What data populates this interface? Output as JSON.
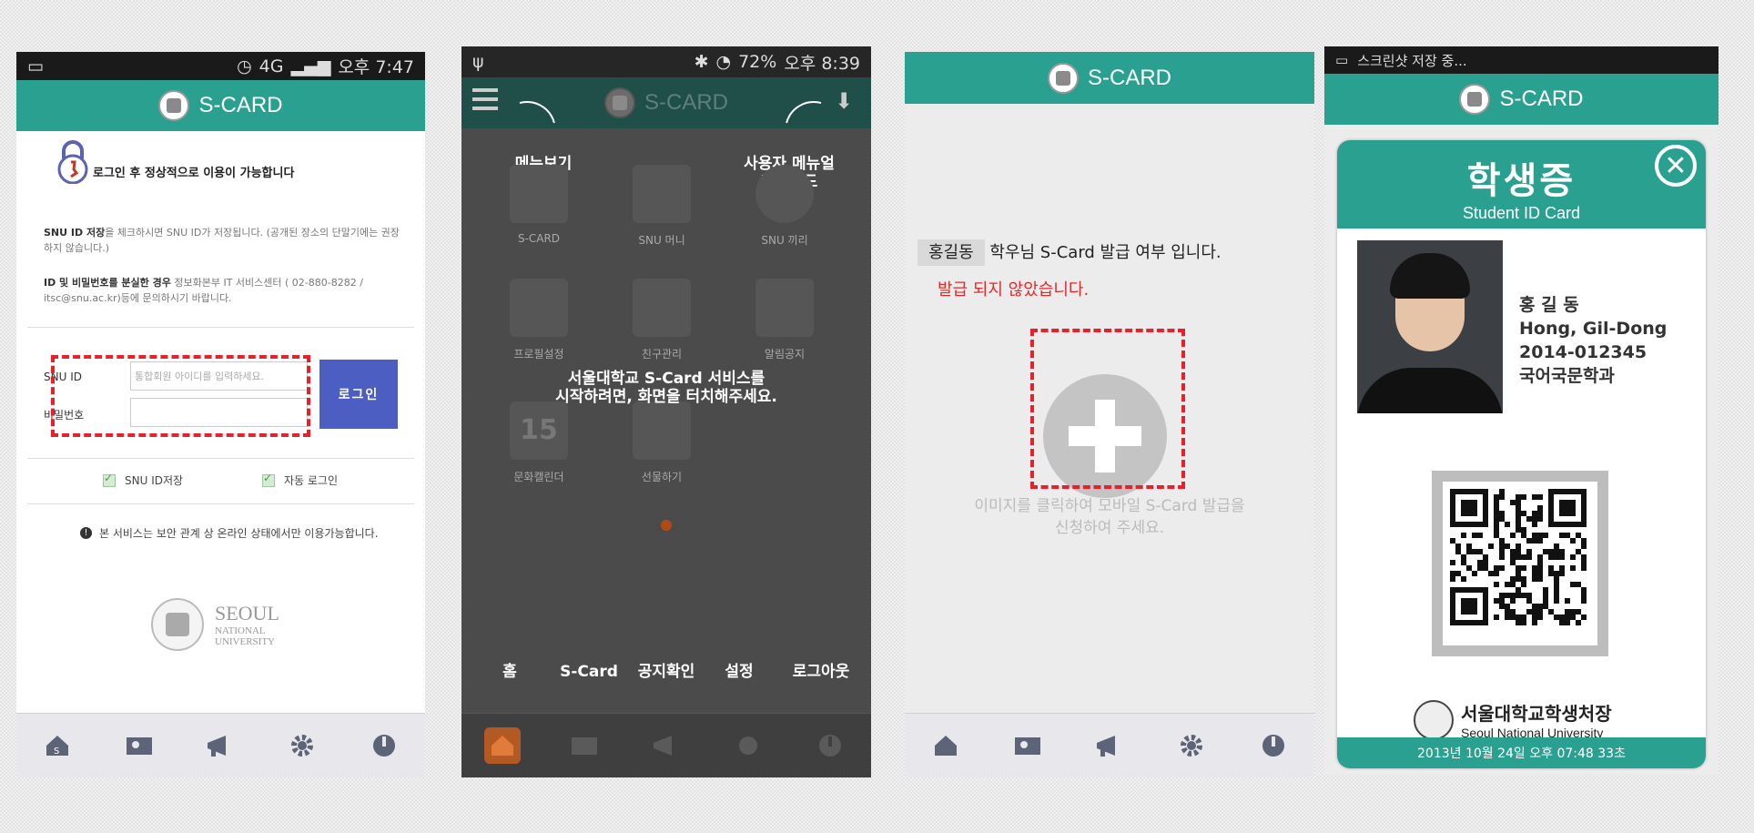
{
  "colors": {
    "teal": "#2aa090",
    "login_blue": "#4d5ec2",
    "alert_red": "#e02a2a",
    "dash_red": "#e8202a"
  },
  "screen1": {
    "status_time": "오후 7:47",
    "status_network": "4G",
    "app_title": "S-CARD",
    "login_heading": "로그인 후 정상적으로 이용이 가능합니다",
    "note1_bold": "SNU ID 저장",
    "note1": "을 체크하시면 SNU ID가 저장됩니다. (공개된 장소의 단말기에는 권장하지 않습니다.)",
    "note2_bold": "ID 및 비밀번호를 분실한 경우",
    "note2": " 정보화본부 IT 서비스센터 ( 02-880-8282 / itsc@snu.ac.kr)등에 문의하시기 바랍니다.",
    "id_label": "SNU ID",
    "id_placeholder": "통합회원 아이디를 입력하세요.",
    "pw_label": "비밀번호",
    "login_button": "로그인",
    "save_id_label": "SNU ID저장",
    "auto_login_label": "자동 로그인",
    "info_text": "본 서비스는 보안 관계 상 온라인 상태에서만 이용가능합니다.",
    "logo_line1": "SEOUL",
    "logo_line2": "NATIONAL",
    "logo_line3": "UNIVERSITY"
  },
  "screen2": {
    "status_time": "오후 8:39",
    "status_battery": "72%",
    "app_title": "S-CARD",
    "tip_menu": "메뉴보기",
    "tip_manual_line1": "사용자 메뉴얼",
    "tip_manual_line2": "다운로드",
    "grid": [
      "S-CARD",
      "SNU 머니",
      "SNU 끼리",
      "프로필설정",
      "친구관리",
      "알림공지",
      "문화캘린더",
      "선물하기"
    ],
    "calendar_day": "15",
    "center_line1": "서울대학교 S-Card 서비스를",
    "center_line2": "시작하려면, 화면을 터치해주세요.",
    "nav_labels": [
      "홈",
      "S-Card",
      "공지확인",
      "설정",
      "로그아웃"
    ]
  },
  "screen3": {
    "app_title": "S-CARD",
    "title_name": "홍길동",
    "title_rest": " 학우님 S-Card 발급 여부 입니다.",
    "not_issued": "발급 되지 않았습니다.",
    "hint_line1": "이미지를 클릭하여 모바일 S-Card 발급을",
    "hint_line2": "신청하여 주세요."
  },
  "screen4": {
    "status_text": "스크린샷 저장 중...",
    "app_title": "S-CARD",
    "card_title_ko": "학생증",
    "card_title_en": "Student ID Card",
    "name_ko": "홍 길 동",
    "name_en": "Hong, Gil-Dong",
    "student_no": "2014-012345",
    "department": "국어국문학과",
    "issuer_ko": "서울대학교학생처장",
    "issuer_en": "Seoul National University",
    "timestamp": "2013년 10월 24일 오후 07:48 33초"
  },
  "icons": [
    "home-icon",
    "card-icon",
    "megaphone-icon",
    "gear-icon",
    "power-icon"
  ]
}
